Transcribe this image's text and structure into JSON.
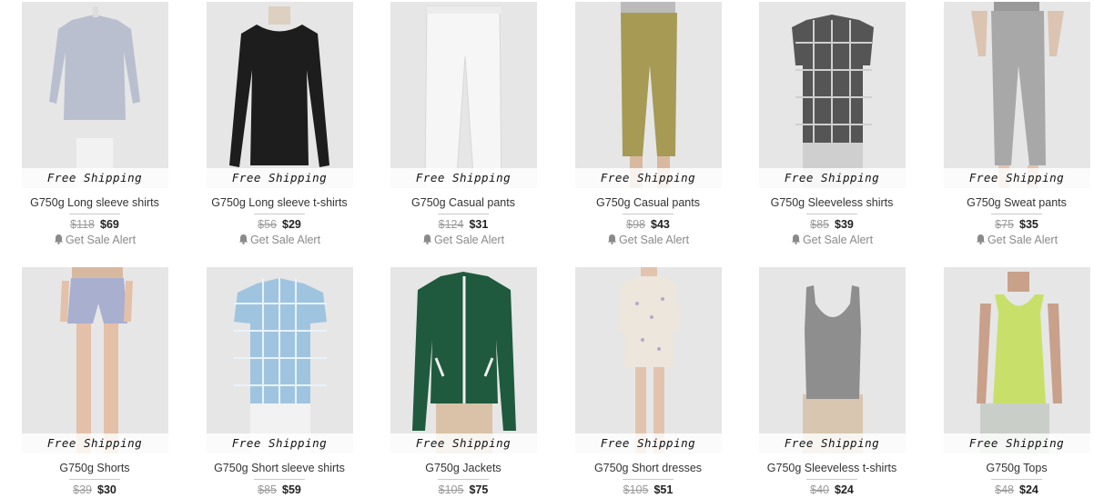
{
  "products": [
    {
      "shipping": "Free Shipping",
      "title": "G750g Long sleeve shirts",
      "old_price": "$118",
      "price": "$69",
      "alert": "Get Sale Alert",
      "icon": "shirt-photo"
    },
    {
      "shipping": "Free Shipping",
      "title": "G750g Long sleeve t-shirts",
      "old_price": "$56",
      "price": "$29",
      "alert": "Get Sale Alert",
      "icon": "tshirt-photo"
    },
    {
      "shipping": "Free Shipping",
      "title": "G750g Casual pants",
      "old_price": "$124",
      "price": "$31",
      "alert": "Get Sale Alert",
      "icon": "white-pants-photo"
    },
    {
      "shipping": "Free Shipping",
      "title": "G750g Casual pants",
      "old_price": "$98",
      "price": "$43",
      "alert": "Get Sale Alert",
      "icon": "olive-pants-photo"
    },
    {
      "shipping": "Free Shipping",
      "title": "G750g Sleeveless shirts",
      "old_price": "$85",
      "price": "$39",
      "alert": "Get Sale Alert",
      "icon": "plaid-shirt-photo"
    },
    {
      "shipping": "Free Shipping",
      "title": "G750g Sweat pants",
      "old_price": "$75",
      "price": "$35",
      "alert": "Get Sale Alert",
      "icon": "sweat-pants-photo"
    },
    {
      "shipping": "Free Shipping",
      "title": "G750g Shorts",
      "old_price": "$39",
      "price": "$30",
      "icon": "shorts-photo"
    },
    {
      "shipping": "Free Shipping",
      "title": "G750g Short sleeve shirts",
      "old_price": "$85",
      "price": "$59",
      "icon": "blue-plaid-shirt-photo"
    },
    {
      "shipping": "Free Shipping",
      "title": "G750g Jackets",
      "old_price": "$105",
      "price": "$75",
      "icon": "jacket-photo"
    },
    {
      "shipping": "Free Shipping",
      "title": "G750g Short dresses",
      "old_price": "$105",
      "price": "$51",
      "icon": "dress-photo"
    },
    {
      "shipping": "Free Shipping",
      "title": "G750g Sleeveless t-shirts",
      "old_price": "$40",
      "price": "$24",
      "icon": "tank-top-photo"
    },
    {
      "shipping": "Free Shipping",
      "title": "G750g Tops",
      "old_price": "$48",
      "price": "$24",
      "icon": "green-top-photo"
    }
  ],
  "colors": {
    "photo_bg": "#e6e6e6",
    "price_old": "#9a9a9a",
    "price_new": "#222222",
    "alert": "#8a8a8a"
  }
}
